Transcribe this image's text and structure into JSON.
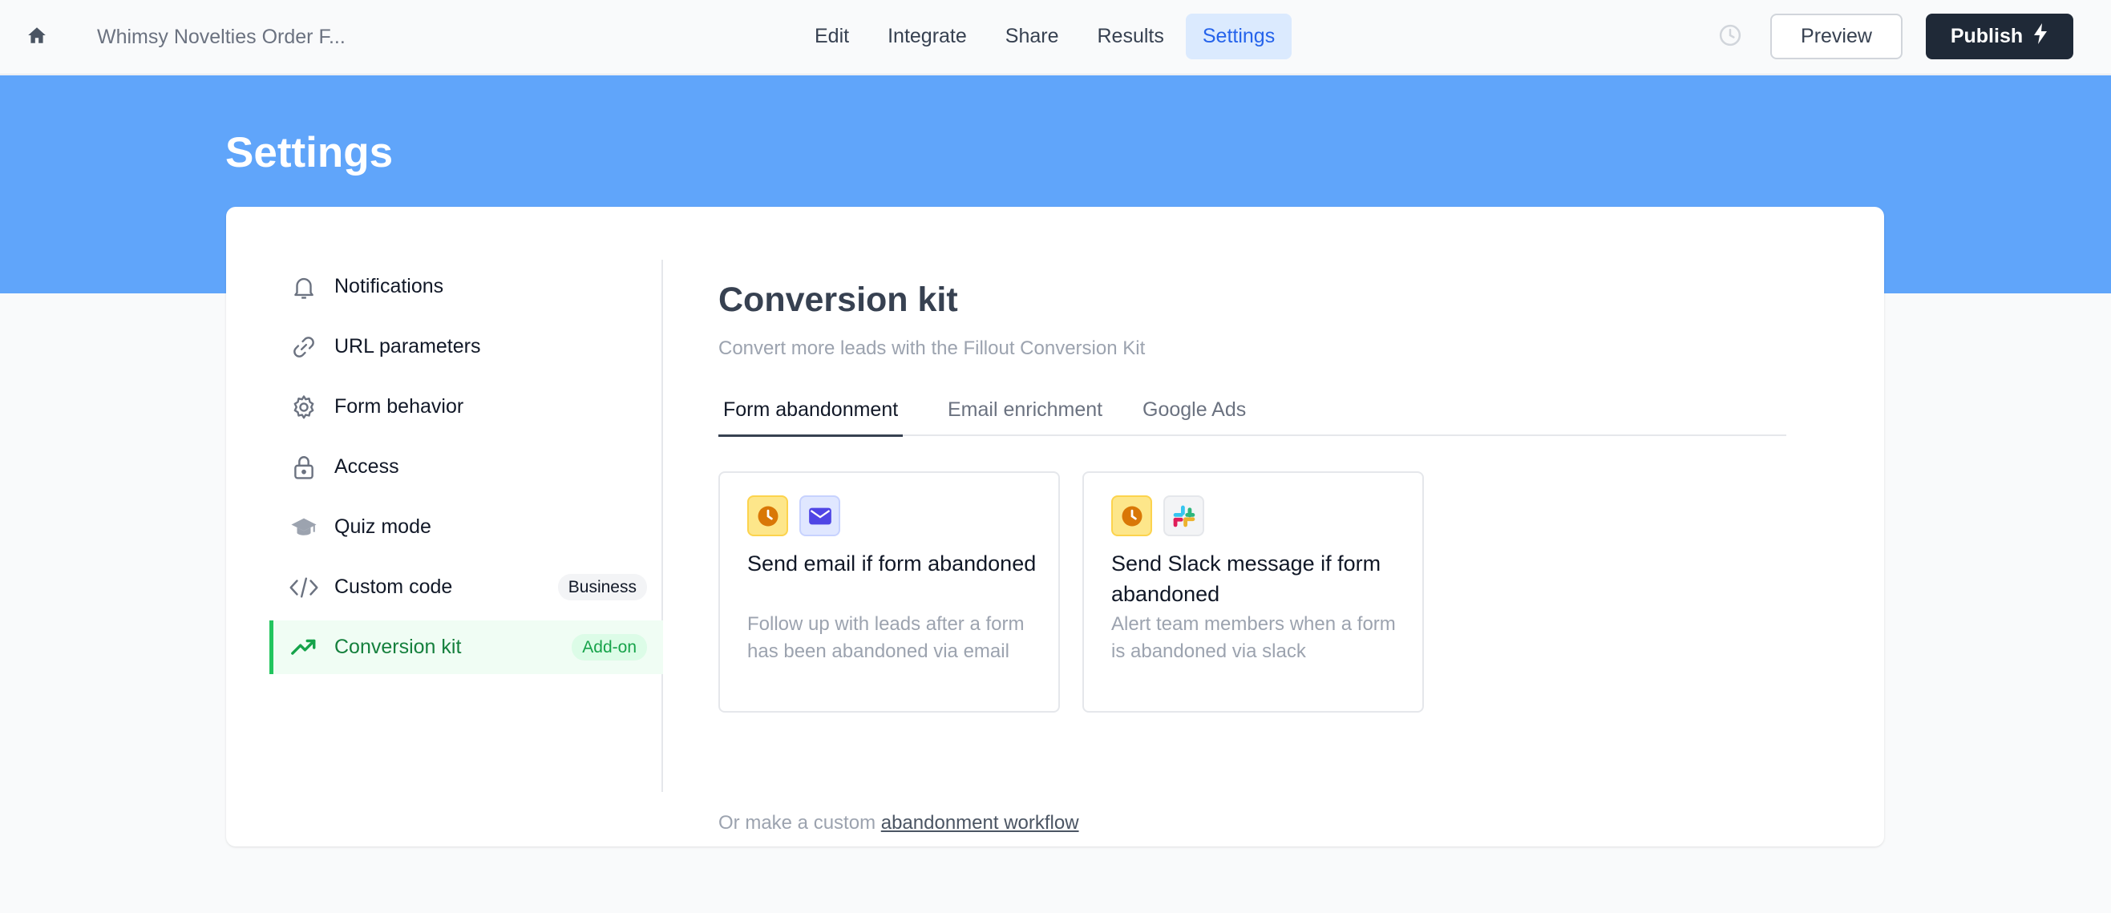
{
  "topbar": {
    "form_title": "Whimsy Novelties Order F...",
    "tabs": [
      {
        "label": "Edit"
      },
      {
        "label": "Integrate"
      },
      {
        "label": "Share"
      },
      {
        "label": "Results"
      },
      {
        "label": "Settings",
        "active": true
      }
    ],
    "preview_label": "Preview",
    "publish_label": "Publish",
    "icons": {
      "home": "home-icon",
      "history": "history-clock-icon",
      "publish": "lightning-icon"
    }
  },
  "header": {
    "title": "Settings"
  },
  "sidebar": {
    "items": [
      {
        "label": "Notifications",
        "icon": "bell-icon"
      },
      {
        "label": "URL parameters",
        "icon": "link-icon"
      },
      {
        "label": "Form behavior",
        "icon": "gear-icon"
      },
      {
        "label": "Access",
        "icon": "lock-icon"
      },
      {
        "label": "Quiz mode",
        "icon": "graduation-cap-icon"
      },
      {
        "label": "Custom code",
        "icon": "code-icon",
        "badge": "Business"
      },
      {
        "label": "Conversion kit",
        "icon": "trending-up-icon",
        "badge": "Add-on",
        "active": true
      }
    ]
  },
  "main": {
    "title": "Conversion kit",
    "subtitle": "Convert more leads with the Fillout Conversion Kit",
    "tabs": [
      {
        "label": "Form abandonment",
        "active": true
      },
      {
        "label": "Email enrichment"
      },
      {
        "label": "Google Ads"
      }
    ],
    "cards": [
      {
        "title": "Send email if form abandoned",
        "description": "Follow up with leads after a form has been abandoned via email",
        "icons": [
          "clock-icon",
          "mail-icon"
        ]
      },
      {
        "title": "Send Slack message if form abandoned",
        "description": "Alert team members when a form is abandoned via slack",
        "icons": [
          "clock-icon",
          "slack-icon"
        ]
      }
    ],
    "custom_prefix": "Or make a custom",
    "custom_link": "abandonment workflow"
  },
  "colors": {
    "accent_blue": "#60a5fa",
    "active_tab_blue": "#2563eb",
    "active_green": "#16a34a",
    "publish_bg": "#1f2937"
  }
}
